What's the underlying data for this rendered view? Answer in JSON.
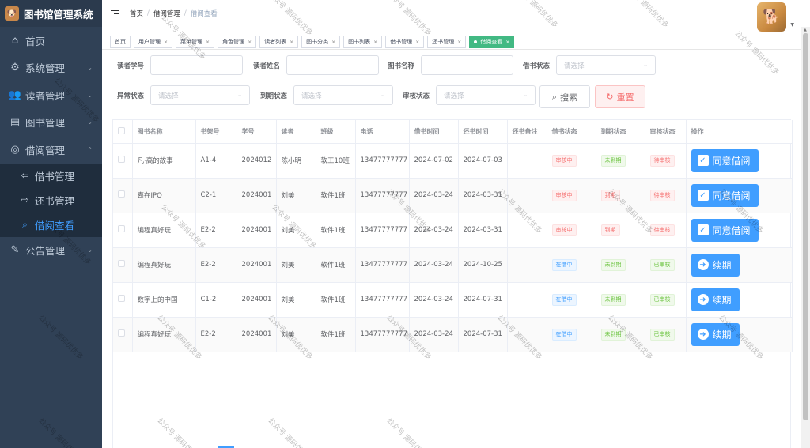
{
  "app": {
    "title": "图书馆管理系统"
  },
  "sidebar": {
    "items": [
      {
        "label": "首页",
        "icon": "home-icon"
      },
      {
        "label": "系统管理",
        "icon": "gear-icon"
      },
      {
        "label": "读者管理",
        "icon": "users-icon"
      },
      {
        "label": "图书管理",
        "icon": "book-icon"
      },
      {
        "label": "借阅管理",
        "icon": "borrow-icon"
      }
    ],
    "sub_items": [
      {
        "label": "借书管理",
        "icon": "arrow-left-icon"
      },
      {
        "label": "还书管理",
        "icon": "arrow-right-icon"
      },
      {
        "label": "借阅查看",
        "icon": "search-icon"
      }
    ],
    "last_item": {
      "label": "公告管理",
      "icon": "edit-icon"
    }
  },
  "breadcrumb": {
    "home": "首页",
    "parent": "借阅管理",
    "current": "借阅查看"
  },
  "tags": [
    "首页",
    "用户管理",
    "菜单管理",
    "角色管理",
    "读者列表",
    "图书分类",
    "图书列表",
    "借书管理",
    "还书管理",
    "借阅查看"
  ],
  "form": {
    "reader_no_label": "读者学号",
    "reader_name_label": "读者姓名",
    "book_name_label": "图书名称",
    "borrow_status_label": "借书状态",
    "abnormal_status_label": "异常状态",
    "due_status_label": "到期状态",
    "audit_status_label": "审核状态",
    "select_placeholder": "请选择",
    "search_label": "搜索",
    "reset_label": "重置"
  },
  "table": {
    "headers": [
      "图书名称",
      "书架号",
      "学号",
      "读者",
      "班级",
      "电话",
      "借书时间",
      "还书时间",
      "还书备注",
      "借书状态",
      "到期状态",
      "审核状态",
      "操作"
    ],
    "rows": [
      {
        "book": "凡·高的故事",
        "shelf": "A1-4",
        "student_no": "2024012",
        "reader": "陈小明",
        "class": "软工10班",
        "phone": "13477777777",
        "borrow_time": "2024-07-02",
        "return_time": "2024-07-03",
        "note": "",
        "borrow_status": "审核中",
        "due_status": "未到期",
        "audit_status": "待审核",
        "action": "同意借阅"
      },
      {
        "book": "嘉在IPO",
        "shelf": "C2-1",
        "student_no": "2024001",
        "reader": "刘美",
        "class": "软件1班",
        "phone": "13477777777",
        "borrow_time": "2024-03-24",
        "return_time": "2024-03-31",
        "note": "",
        "borrow_status": "审核中",
        "due_status": "到期",
        "audit_status": "待审核",
        "action": "同意借阅"
      },
      {
        "book": "编程真好玩",
        "shelf": "E2-2",
        "student_no": "2024001",
        "reader": "刘美",
        "class": "软件1班",
        "phone": "13477777777",
        "borrow_time": "2024-03-24",
        "return_time": "2024-03-31",
        "note": "",
        "borrow_status": "审核中",
        "due_status": "到期",
        "audit_status": "待审核",
        "action": "同意借阅"
      },
      {
        "book": "编程真好玩",
        "shelf": "E2-2",
        "student_no": "2024001",
        "reader": "刘美",
        "class": "软件1班",
        "phone": "13477777777",
        "borrow_time": "2024-03-24",
        "return_time": "2024-10-25",
        "note": "",
        "borrow_status": "在借中",
        "due_status": "未到期",
        "audit_status": "已审核",
        "action": "续期"
      },
      {
        "book": "数字上的中国",
        "shelf": "C1-2",
        "student_no": "2024001",
        "reader": "刘美",
        "class": "软件1班",
        "phone": "13477777777",
        "borrow_time": "2024-03-24",
        "return_time": "2024-07-31",
        "note": "",
        "borrow_status": "在借中",
        "due_status": "未到期",
        "audit_status": "已审核",
        "action": "续期"
      },
      {
        "book": "编程真好玩",
        "shelf": "E2-2",
        "student_no": "2024001",
        "reader": "刘美",
        "class": "软件1班",
        "phone": "13477777777",
        "borrow_time": "2024-03-24",
        "return_time": "2024-07-31",
        "note": "",
        "borrow_status": "在借中",
        "due_status": "未到期",
        "audit_status": "已审核",
        "action": "续期"
      }
    ]
  },
  "watermark": "公众号 源码优优多",
  "colors": {
    "sidebar_bg": "#304156",
    "active": "#409eff",
    "tag_active": "#42b983",
    "danger": "#f56c6c",
    "success": "#67c23a"
  }
}
